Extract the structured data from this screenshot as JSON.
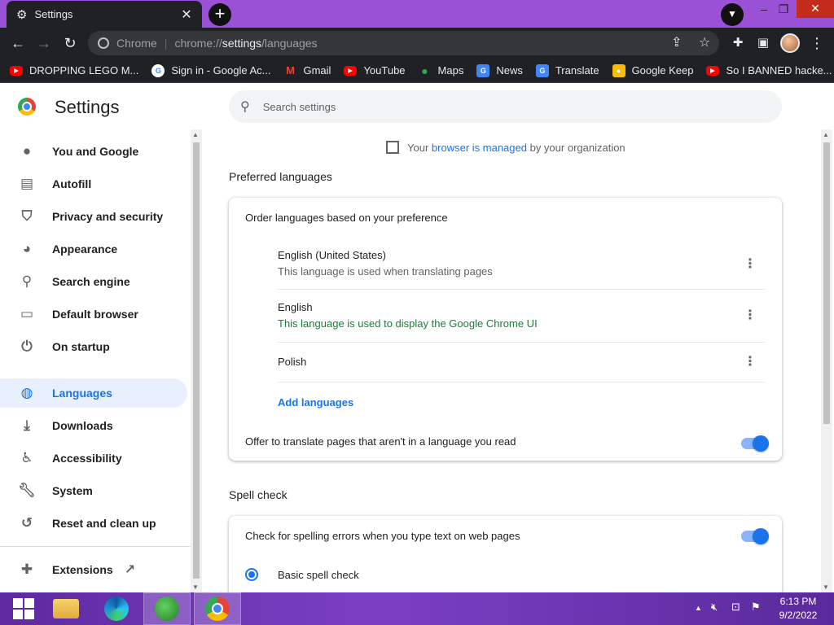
{
  "browser": {
    "tab": {
      "title": "Settings",
      "icon": "gear-icon"
    },
    "new_tab_label": "+",
    "window_controls": {
      "minimize": "–",
      "maximize": "❐",
      "close": "✕"
    },
    "url": {
      "scheme": "Chrome",
      "prefix": "chrome://",
      "host": "settings",
      "path": "/languages"
    },
    "bookmarks": [
      {
        "label": "DROPPING LEGO M...",
        "icon": "youtube-icon"
      },
      {
        "label": "Sign in - Google Ac...",
        "icon": "google-icon"
      },
      {
        "label": "Gmail",
        "icon": "gmail-icon"
      },
      {
        "label": "YouTube",
        "icon": "youtube-icon"
      },
      {
        "label": "Maps",
        "icon": "maps-icon"
      },
      {
        "label": "News",
        "icon": "news-icon"
      },
      {
        "label": "Translate",
        "icon": "translate-icon"
      },
      {
        "label": "Google Keep",
        "icon": "keep-icon"
      },
      {
        "label": "So I BANNED hacke...",
        "icon": "youtube-icon"
      }
    ]
  },
  "settings": {
    "title": "Settings",
    "search_placeholder": "Search settings",
    "nav": [
      {
        "label": "You and Google",
        "icon": "person-icon"
      },
      {
        "label": "Autofill",
        "icon": "clipboard-icon"
      },
      {
        "label": "Privacy and security",
        "icon": "shield-icon"
      },
      {
        "label": "Appearance",
        "icon": "palette-icon"
      },
      {
        "label": "Search engine",
        "icon": "search-icon"
      },
      {
        "label": "Default browser",
        "icon": "browser-icon"
      },
      {
        "label": "On startup",
        "icon": "power-icon"
      },
      {
        "label": "Languages",
        "icon": "globe-icon",
        "active": true
      },
      {
        "label": "Downloads",
        "icon": "download-icon"
      },
      {
        "label": "Accessibility",
        "icon": "accessibility-icon"
      },
      {
        "label": "System",
        "icon": "wrench-icon"
      },
      {
        "label": "Reset and clean up",
        "icon": "restore-icon"
      },
      {
        "label": "Extensions",
        "icon": "puzzle-icon"
      }
    ],
    "managed": {
      "prefix": "Your ",
      "link": "browser is managed",
      "suffix": " by your organization"
    },
    "preferred_languages": {
      "title": "Preferred languages",
      "order_label": "Order languages based on your preference",
      "languages": [
        {
          "name": "English (United States)",
          "note": "This language is used when translating pages"
        },
        {
          "name": "English",
          "note": "This language is used to display the Google Chrome UI"
        },
        {
          "name": "Polish",
          "note": ""
        }
      ],
      "add_label": "Add languages",
      "offer_translate_label": "Offer to translate pages that aren't in a language you read",
      "offer_translate_on": true
    },
    "spell_check": {
      "title": "Spell check",
      "check_label": "Check for spelling errors when you type text on web pages",
      "check_on": true,
      "basic_label": "Basic spell check",
      "basic_selected": true
    }
  },
  "taskbar": {
    "time": "6:13 PM",
    "date": "9/2/2022"
  },
  "colors": {
    "accent": "#1a73e8",
    "frame": "#9b51d6",
    "toolbar": "#202124",
    "green_note": "#188038"
  }
}
